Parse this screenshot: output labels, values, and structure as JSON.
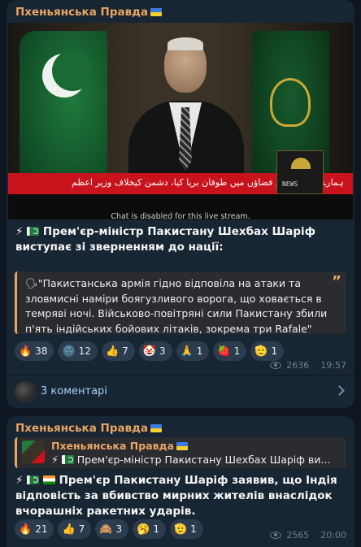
{
  "posts": [
    {
      "channel": "Пхеньянська Правда",
      "video": {
        "ticker_text": "ہمارے شاہینوں نے فضاؤں میں طوفان برپا کیا، دشمن کیخلاف وزیر اعظم",
        "logo_label": "NEWS",
        "notice": "Chat is disabled for this live stream."
      },
      "headline": "Прем'єр-міністр Пакистану Шехбах Шаріф виступає зі зверненням до нації:",
      "quote": "\"Пакистанська армія гідно відповіла на атаки та зловмисні наміри боягузливого ворога, що ховається в темряві ночі. Військово-повітряні сили Пакистану збили п'ять індійських бойових літаків, зокрема три Rafale\"",
      "reactions": [
        {
          "emoji": "🔥",
          "count": "38"
        },
        {
          "emoji": "🌚",
          "count": "12"
        },
        {
          "emoji": "👍",
          "count": "7"
        },
        {
          "emoji": "🤡",
          "count": "3"
        },
        {
          "emoji": "🙏",
          "count": "1"
        },
        {
          "emoji": "🍓",
          "count": "1"
        },
        {
          "emoji": "🫡",
          "count": "1"
        }
      ],
      "views": "2636",
      "time": "19:57",
      "comments": "3 коментарі"
    },
    {
      "channel": "Пхеньянська Правда",
      "forward": {
        "name": "Пхеньянська Правда",
        "text": "Прем'єр-міністр Пакистану Шехбах Шаріф ви..."
      },
      "headline": "Прем'єр Пакистану Шаріф заявив, що Індія відповість за вбивство мирних жителів внаслідок вчорашніх ракетних ударів.",
      "reactions": [
        {
          "emoji": "🔥",
          "count": "21"
        },
        {
          "emoji": "👍",
          "count": "7"
        },
        {
          "emoji": "🙈",
          "count": "3"
        },
        {
          "emoji": "🥱",
          "count": "1"
        },
        {
          "emoji": "🫡",
          "count": "1"
        }
      ],
      "views": "2565",
      "time": "20:00"
    }
  ],
  "icons": [
    "lightning-icon",
    "pakistan-flag-icon",
    "india-flag-icon",
    "quote-icon",
    "eye-icon",
    "chevron-right-icon"
  ]
}
